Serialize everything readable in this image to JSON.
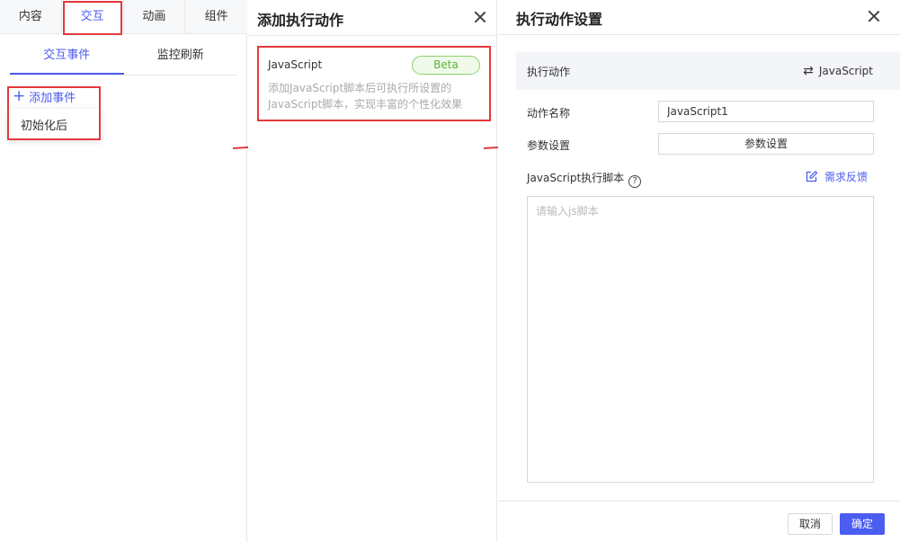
{
  "left_panel": {
    "top_tabs": [
      {
        "label": "内容",
        "active": false
      },
      {
        "label": "交互",
        "active": true
      },
      {
        "label": "动画",
        "active": false
      },
      {
        "label": "组件",
        "active": false
      }
    ],
    "sub_tabs": [
      {
        "label": "交互事件",
        "active": true
      },
      {
        "label": "监控刷新",
        "active": false
      }
    ],
    "add_event_label": "添加事件",
    "dropdown_items": [
      "初始化后"
    ]
  },
  "middle_panel": {
    "title": "添加执行动作",
    "card": {
      "title": "JavaScript",
      "badge": "Beta",
      "description": "添加JavaScript脚本后可执行所设置的JavaScript脚本，实现丰富的个性化效果"
    }
  },
  "right_panel": {
    "title": "执行动作设置",
    "action_label": "执行动作",
    "action_value": "JavaScript",
    "name_label": "动作名称",
    "name_value": "JavaScript1",
    "param_label": "参数设置",
    "param_button": "参数设置",
    "script_label": "JavaScript执行脚本",
    "help_glyph": "?",
    "feedback_label": "需求反馈",
    "script_placeholder": "请输入js脚本",
    "cancel_label": "取消",
    "ok_label": "确定"
  },
  "colors": {
    "accent": "#4b5cf0",
    "highlight_red": "#e4393c",
    "beta_green": "#5bb531"
  }
}
